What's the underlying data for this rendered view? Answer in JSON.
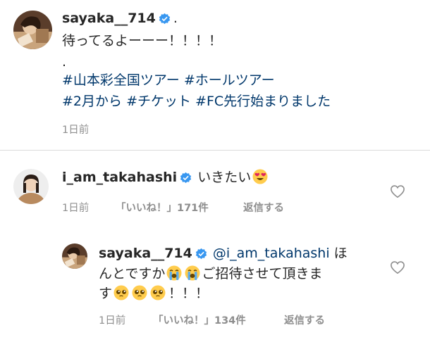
{
  "caption": {
    "username": "sayaka__714",
    "dot": ".",
    "line1": "待ってるよーーー！！！！",
    "line2": ".",
    "hashtags_row1": [
      "#山本彩全国ツアー",
      "#ホールツアー"
    ],
    "hashtags_row2": [
      "#2月から",
      "#チケット",
      "#FC先行始まりました"
    ],
    "time": "1日前"
  },
  "comments": [
    {
      "username": "i_am_takahashi",
      "text": "いきたい",
      "emoji": "heart-eyes-emoji",
      "time": "1日前",
      "likes": "「いいね！」171件",
      "reply": "返信する"
    }
  ],
  "replies": [
    {
      "username": "sayaka__714",
      "mention": "@i_am_takahashi",
      "text_a": " ほ",
      "text_b": "んとですか",
      "text_c": "ご招待させて頂きま",
      "text_d": "す",
      "text_e": "！！！",
      "emojis": [
        "loudly-crying-emoji",
        "pleading-emoji"
      ],
      "time": "1日前",
      "likes": "「いいね！」134件",
      "reply": "返信する"
    }
  ],
  "colors": {
    "text": "#262626",
    "hashtag": "#00376b",
    "meta": "#8e8e8e",
    "verified": "#3897f0",
    "divider": "#dbdbdb"
  },
  "icons": [
    "verified-badge-icon",
    "heart-outline-icon"
  ]
}
